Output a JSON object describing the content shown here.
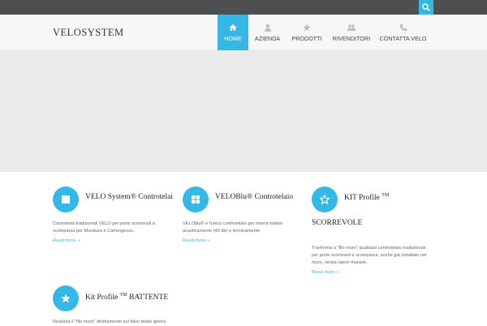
{
  "site": {
    "logo": "VELOSYSTEM"
  },
  "nav": {
    "items": [
      {
        "label": "HOME",
        "icon": "home-icon",
        "active": true
      },
      {
        "label": "AZIENDA",
        "icon": "user-icon",
        "active": false
      },
      {
        "label": "PRODOTTI",
        "icon": "star-icon",
        "active": false
      },
      {
        "label": "RIVENDITORI",
        "icon": "users-icon",
        "active": false
      },
      {
        "label": "CONTATTA VELO",
        "icon": "phone-icon",
        "active": false
      }
    ]
  },
  "features": [
    {
      "title": "VELO System® Controtelai",
      "icon": "square-icon",
      "text": [
        "Controtelai  tradizionali VELO per porte scorrevoli a",
        "scomparsa per Muratura e Cartongesso."
      ],
      "more": "Read more"
    },
    {
      "title": "VELOBlu® Controtelaio",
      "icon": "grid-icon",
      "text": [
        "VELOblu®  è l'unico controtelaio per interni isolato",
        "acusticamente (43 db) e termicamente"
      ],
      "more": "Read more"
    },
    {
      "title": "KIT Profile",
      "title_sup": "TM",
      "title_line2": "SCORREVOLE",
      "icon": "star-outline-icon",
      "text": [
        "Trasforma a \"filo muro\" qualsiasi controtelaio tradizionale",
        "per porte scorrevoli a scomparsa, anche già installato nel",
        "muro, senza opere murarie."
      ],
      "more": "Read more"
    },
    {
      "title": "Kit Profile",
      "title_sup": "TM",
      "title_after": " BATTENTE",
      "icon": "star-icon",
      "text": [
        "Realizza il \"filo muro\" direttamente sul falso telaio ignora"
      ],
      "more": ""
    }
  ],
  "colors": {
    "accent": "#34b8e6",
    "topbar": "#4d4f51",
    "hero": "#ebebeb"
  }
}
